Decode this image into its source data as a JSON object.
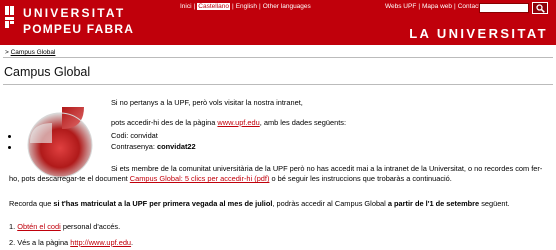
{
  "header": {
    "logo_line1": "UNIVERSITAT",
    "logo_line2": "POMPEU FABRA",
    "languages": [
      "Inici",
      "Castellano",
      "English",
      "Other languages"
    ],
    "selected_language_index": 1,
    "top_links": [
      "Webs UPF",
      "Mapa web",
      "Contacte"
    ],
    "search_placeholder": "",
    "university_title": "LA UNIVERSITAT",
    "brand_color": "#c0000b"
  },
  "breadcrumb": {
    "prefix": ">",
    "link": "Campus Global"
  },
  "page": {
    "title": "Campus Global",
    "intro_line1": "Si no pertanys a la UPF, però vols visitar la nostra intranet,",
    "intro_line2_pre": "pots accedir-hi des de la pàgina ",
    "intro_line2_link": "www.upf.edu",
    "intro_line2_post": ", amb les dades següents:",
    "code_label": "Codi: ",
    "code_value": "convidat",
    "password_label": "Contrasenya: ",
    "password_value": "convidat22",
    "member_text_1": "Si ets membre de la comunitat universitària de la UPF però no has accedit mai a la intranet de la Universitat, o no recordes com fer-ho, pots descarregar-te el document ",
    "member_link": "Campus Global: 5 clics per accedir-hi (pdf)",
    "member_text_2": " o bé seguir les instruccions que trobaràs a continuació.",
    "remember_pre": "Recorda que ",
    "remember_bold1": "si t'has matriculat a la UPF per primera vegada al mes de juliol",
    "remember_mid": ", podràs accedir al Campus Global ",
    "remember_bold2": "a partir de l'1 de setembre",
    "remember_post": " següent.",
    "step1_num": "1. ",
    "step1_link": "Obtén el codi",
    "step1_post": " personal d'accés.",
    "step2_pre": "2. Vés a la pàgina ",
    "step2_link": "http://www.upf.edu",
    "step2_post": "."
  }
}
